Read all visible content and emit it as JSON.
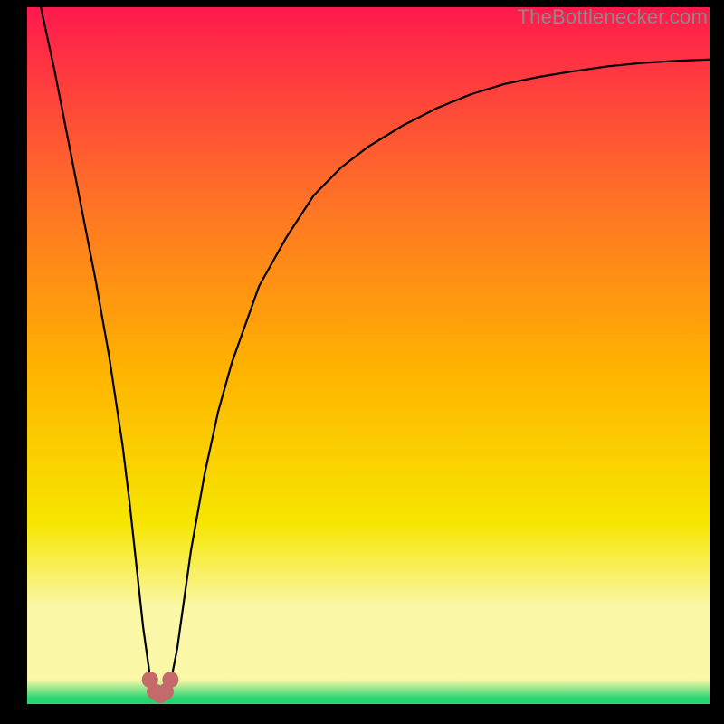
{
  "watermark": "TheBottlenecker.com",
  "colors": {
    "top": "#ff1a4d",
    "upper_mid": "#ff6a2a",
    "mid": "#ffb300",
    "lower_mid": "#f6e600",
    "pale": "#faf7a6",
    "bottom": "#27d671",
    "curve": "#000000",
    "marker": "#c46a6a",
    "frame": "#000000"
  },
  "chart_data": {
    "type": "line",
    "title": "",
    "xlabel": "",
    "ylabel": "",
    "xlim": [
      0,
      100
    ],
    "ylim": [
      0,
      100
    ],
    "series": [
      {
        "name": "bottleneck-curve",
        "x": [
          2,
          4,
          6,
          8,
          10,
          12,
          14,
          15,
          16,
          17,
          18,
          19,
          20,
          21,
          22,
          23,
          24,
          26,
          28,
          30,
          34,
          38,
          42,
          46,
          50,
          55,
          60,
          65,
          70,
          75,
          80,
          85,
          90,
          95,
          100
        ],
        "y": [
          100,
          91,
          81,
          71,
          61,
          50,
          37,
          29,
          20,
          11,
          4,
          1.5,
          1.5,
          3,
          8,
          15,
          22,
          33,
          42,
          49,
          60,
          67,
          73,
          77,
          80,
          83,
          85.5,
          87.5,
          89,
          90,
          90.8,
          91.5,
          92,
          92.3,
          92.5
        ]
      }
    ],
    "markers": {
      "name": "valley-markers",
      "points": [
        {
          "x": 18.0,
          "y": 3.5
        },
        {
          "x": 18.7,
          "y": 1.8
        },
        {
          "x": 19.5,
          "y": 1.3
        },
        {
          "x": 20.3,
          "y": 1.8
        },
        {
          "x": 21.0,
          "y": 3.5
        }
      ],
      "radius": 9
    },
    "gradient_stops": [
      {
        "offset": 0.0,
        "key": "top"
      },
      {
        "offset": 0.25,
        "key": "upper_mid"
      },
      {
        "offset": 0.52,
        "key": "mid"
      },
      {
        "offset": 0.74,
        "key": "lower_mid"
      },
      {
        "offset": 0.86,
        "key": "pale"
      },
      {
        "offset": 0.965,
        "key": "pale"
      },
      {
        "offset": 0.992,
        "key": "bottom"
      },
      {
        "offset": 1.0,
        "key": "bottom"
      }
    ]
  }
}
